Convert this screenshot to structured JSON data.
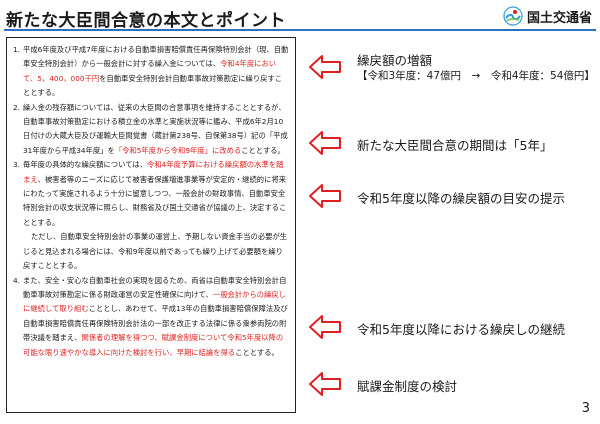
{
  "header": {
    "title": "新たな大臣間合意の本文とポイント",
    "org_name": "国土交通省",
    "accent_color": "#2f6fbf"
  },
  "document": {
    "items": [
      {
        "number": "1.",
        "segments": [
          {
            "text": "平成6年度及び平成7年度における自動車損害賠償責任再保険特別会計（現、自動車安全特別会計）から一般会計に対する繰入金については、",
            "red": false
          },
          {
            "text": "令和4年度において、5，400，000千円",
            "red": true
          },
          {
            "text": "を自動車安全特別会計自動車事故対策勘定に繰り戻すこととする。",
            "red": false
          }
        ]
      },
      {
        "number": "2.",
        "segments": [
          {
            "text": "繰入金の残存額については、従来の大臣間の合意事項を維持することとするが、自動車事故対策勘定における積立金の水準と実施状況等に鑑み、平成6年2月10日付けの大蔵大臣及び運輸大臣間覚書（蔵計第238号、自保第38号）記の「平成31年度から平成34年度」を",
            "red": false
          },
          {
            "text": "「令和5年度から令和9年度」に改める",
            "red": true
          },
          {
            "text": "こととする。",
            "red": false
          }
        ]
      },
      {
        "number": "3.",
        "segments": [
          {
            "text": "毎年度の具体的な繰戻額については、",
            "red": false
          },
          {
            "text": "令和4年度予算における繰戻額の水準を踏まえ",
            "red": true
          },
          {
            "text": "、被害者等のニーズに応じて被害者保護増進事業等が安定的・継続的に将来にわたって実施されるよう十分に留意しつつ、一般会計の財政事情、自動車安全特別会計の収支状況等に照らし、財務省及び国土交通省が協議の上、決定することとする。",
            "red": false
          }
        ],
        "extra": "ただし、自動車安全特別会計の事業の運営上、予期しない資金手当の必要が生じると見込まれる場合には、令和9年度以前であっても繰り上げて必要額を繰り戻すこととする。"
      },
      {
        "number": "4.",
        "segments": [
          {
            "text": "また、安全・安心な自動車社会の実現を図るため、両省は自動車安全特別会計自動車事故対策勘定に係る財政運営の安定性確保に向けて、",
            "red": false
          },
          {
            "text": "一般会計からの繰戻しに継続して取り組む",
            "red": true
          },
          {
            "text": "こととし、あわせて、平成13年の自動車損害賠償保障法及び自動車損害賠償責任再保険特別会計法の一部を改正する法律に係る衆参両院の附帯決議を踏まえ、",
            "red": false
          },
          {
            "text": "関係者の理解を得つつ、賦課金制度について令和5年度以降の可能な限り速やかな導入に向けた検討を行い、早期に結論を得る",
            "red": true
          },
          {
            "text": "こととする。",
            "red": false
          }
        ]
      }
    ]
  },
  "notes": [
    {
      "title": "繰戻額の増額",
      "sub": "【令和3年度：47億円　→　令和4年度：54億円】"
    },
    {
      "title": "新たな大臣間合意の期間は「5年」",
      "sub": ""
    },
    {
      "title": "令和5年度以降の繰戻額の目安の提示",
      "sub": ""
    },
    {
      "title": "令和5年度以降における繰戻しの継続",
      "sub": ""
    },
    {
      "title": "賦課金制度の検討",
      "sub": ""
    }
  ],
  "arrow_color": "#e02020",
  "page_number": "3"
}
